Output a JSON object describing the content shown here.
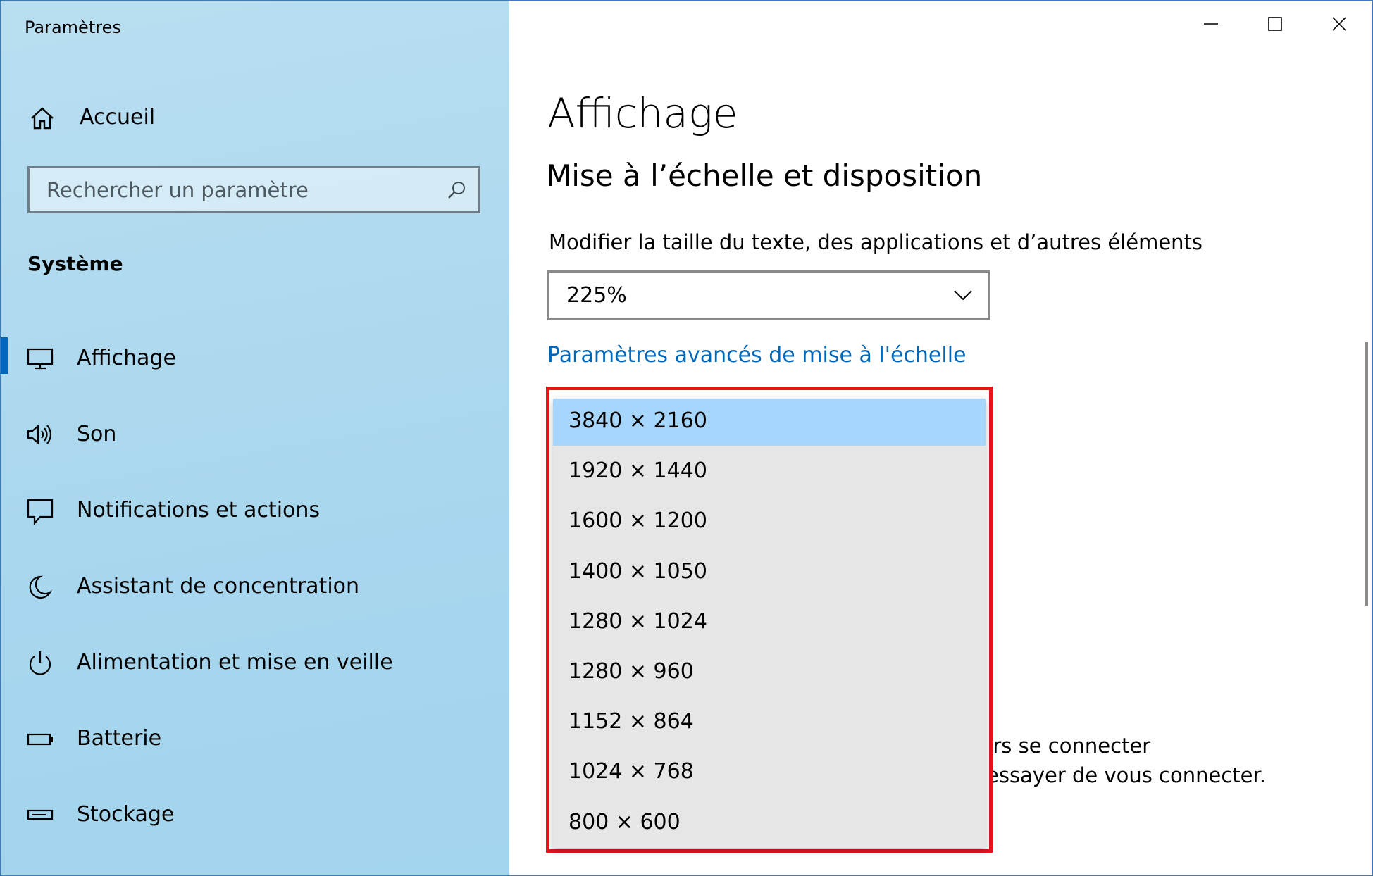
{
  "window": {
    "title": "Paramètres"
  },
  "sidebar": {
    "home_label": "Accueil",
    "search_placeholder": "Rechercher un paramètre",
    "section_title": "Système",
    "items": [
      {
        "label": "Affichage",
        "icon": "monitor-icon",
        "active": true
      },
      {
        "label": "Son",
        "icon": "speaker-icon",
        "active": false
      },
      {
        "label": "Notifications et actions",
        "icon": "notification-icon",
        "active": false
      },
      {
        "label": "Assistant de concentration",
        "icon": "moon-icon",
        "active": false
      },
      {
        "label": "Alimentation et mise en veille",
        "icon": "power-icon",
        "active": false
      },
      {
        "label": "Batterie",
        "icon": "battery-icon",
        "active": false
      },
      {
        "label": "Stockage",
        "icon": "storage-icon",
        "active": false
      }
    ]
  },
  "main": {
    "page_title": "Affichage",
    "section_title": "Mise à l’échelle et disposition",
    "scale_label": "Modifier la taille du texte, des applications et d’autres éléments",
    "scale_value": "225%",
    "advanced_link": "Paramètres avancés de mise à l'échelle",
    "partial_text_1": "urs se connecter",
    "partial_text_2": "essayer de vous connecter."
  },
  "resolution_dropdown": {
    "options": [
      "3840 × 2160",
      "1920 × 1440",
      "1600 × 1200",
      "1400 × 1050",
      "1280 × 1024",
      "1280 × 960",
      "1152 × 864",
      "1024 × 768",
      "800 × 600"
    ],
    "selected_index": 0,
    "highlight_color": "#e8141c",
    "selected_bg": "#a6d6fb"
  },
  "colors": {
    "sidebar_bg": "#a9d7ee",
    "accent": "#0067c0",
    "link": "#0067b8"
  }
}
